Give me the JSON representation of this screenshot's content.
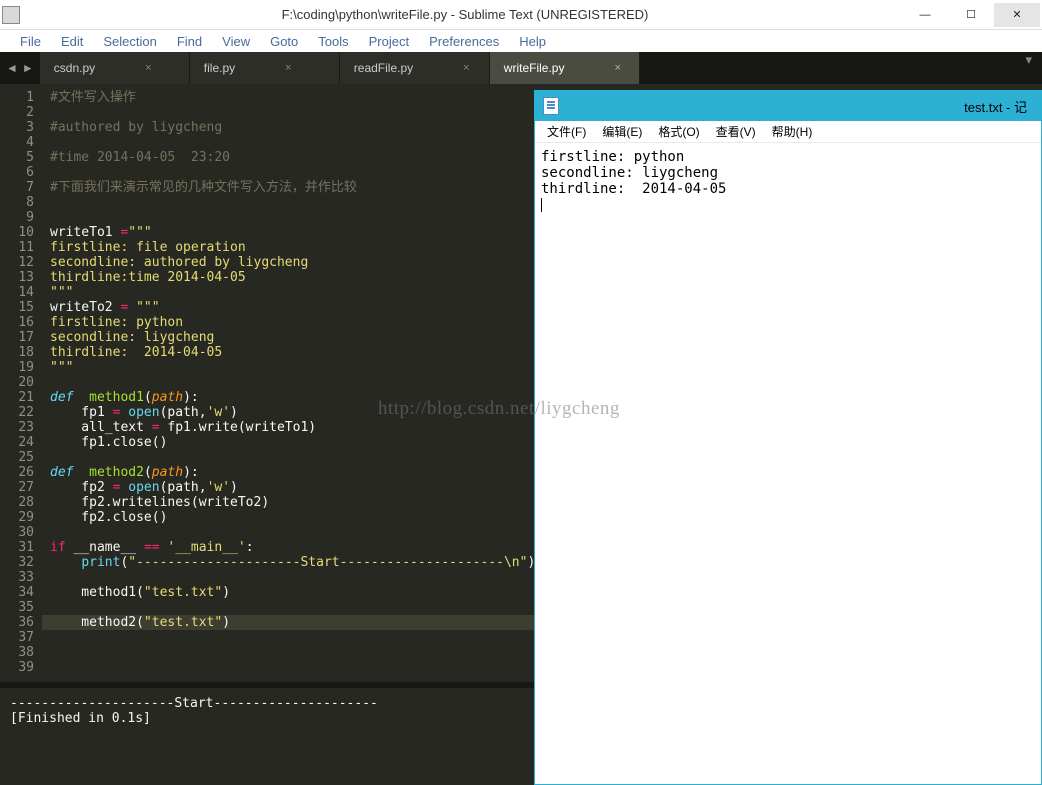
{
  "window": {
    "title": "F:\\coding\\python\\writeFile.py - Sublime Text (UNREGISTERED)"
  },
  "menus": [
    "File",
    "Edit",
    "Selection",
    "Find",
    "View",
    "Goto",
    "Tools",
    "Project",
    "Preferences",
    "Help"
  ],
  "tabs": [
    {
      "label": "csdn.py",
      "active": false
    },
    {
      "label": "file.py",
      "active": false
    },
    {
      "label": "readFile.py",
      "active": false
    },
    {
      "label": "writeFile.py",
      "active": true
    }
  ],
  "code": {
    "lines": [
      {
        "n": 1,
        "t": "comment",
        "s": "#文件写入操作"
      },
      {
        "n": 2,
        "t": "blank",
        "s": ""
      },
      {
        "n": 3,
        "t": "comment",
        "s": "#authored by liygcheng"
      },
      {
        "n": 4,
        "t": "blank",
        "s": ""
      },
      {
        "n": 5,
        "t": "comment",
        "s": "#time 2014-04-05  23:20"
      },
      {
        "n": 6,
        "t": "blank",
        "s": ""
      },
      {
        "n": 7,
        "t": "comment",
        "s": "#下面我们来演示常见的几种文件写入方法，并作比较"
      },
      {
        "n": 8,
        "t": "blank",
        "s": ""
      },
      {
        "n": 9,
        "t": "blank",
        "s": ""
      },
      {
        "n": 10,
        "t": "assign",
        "var": "writeTo1",
        "val": "\"\"\""
      },
      {
        "n": 11,
        "t": "str",
        "s": "firstline: file operation"
      },
      {
        "n": 12,
        "t": "str",
        "s": "secondline: authored by liygcheng"
      },
      {
        "n": 13,
        "t": "str",
        "s": "thirdline:time 2014-04-05"
      },
      {
        "n": 14,
        "t": "str",
        "s": "\"\"\""
      },
      {
        "n": 15,
        "t": "assign",
        "var": "writeTo2",
        "val": "\"\"\""
      },
      {
        "n": 16,
        "t": "str",
        "s": "firstline: python"
      },
      {
        "n": 17,
        "t": "str",
        "s": "secondline: liygcheng"
      },
      {
        "n": 18,
        "t": "str",
        "s": "thirdline:  2014-04-05"
      },
      {
        "n": 19,
        "t": "str",
        "s": "\"\"\""
      },
      {
        "n": 20,
        "t": "blank",
        "s": ""
      },
      {
        "n": 21,
        "t": "def",
        "name": "method1",
        "param": "path"
      },
      {
        "n": 22,
        "t": "open",
        "var": "fp1",
        "arg": "path",
        "mode": "'w'"
      },
      {
        "n": 23,
        "t": "assign2",
        "var": "all_text",
        "rhs_obj": "fp1",
        "rhs_m": "write",
        "rhs_arg": "writeTo1"
      },
      {
        "n": 24,
        "t": "call",
        "obj": "fp1",
        "m": "close"
      },
      {
        "n": 25,
        "t": "blank",
        "s": ""
      },
      {
        "n": 26,
        "t": "def",
        "name": "method2",
        "param": "path"
      },
      {
        "n": 27,
        "t": "open",
        "var": "fp2",
        "arg": "path",
        "mode": "'w'"
      },
      {
        "n": 28,
        "t": "call",
        "obj": "fp2",
        "m": "writelines",
        "arg": "writeTo2"
      },
      {
        "n": 29,
        "t": "call",
        "obj": "fp2",
        "m": "close"
      },
      {
        "n": 30,
        "t": "blank",
        "s": ""
      },
      {
        "n": 31,
        "t": "ifmain"
      },
      {
        "n": 32,
        "t": "print",
        "s": "\"---------------------Start---------------------\\n\""
      },
      {
        "n": 33,
        "t": "blank",
        "s": ""
      },
      {
        "n": 34,
        "t": "callfn",
        "fn": "method1",
        "arg": "\"test.txt\""
      },
      {
        "n": 35,
        "t": "blank",
        "s": ""
      },
      {
        "n": 36,
        "t": "callfn",
        "fn": "method2",
        "arg": "\"test.txt\"",
        "hl": true
      },
      {
        "n": 37,
        "t": "blank",
        "s": ""
      },
      {
        "n": 38,
        "t": "blank",
        "s": ""
      },
      {
        "n": 39,
        "t": "blank",
        "s": ""
      }
    ]
  },
  "console": {
    "line1": "---------------------Start---------------------",
    "line2": "",
    "line3": "[Finished in 0.1s]"
  },
  "notepad": {
    "title": "test.txt - 记",
    "menus": [
      "文件(F)",
      "编辑(E)",
      "格式(O)",
      "查看(V)",
      "帮助(H)"
    ],
    "content": "firstline: python\nsecondline: liygcheng\nthirdline:  2014-04-05"
  },
  "watermark": "http://blog.csdn.net/liygcheng"
}
